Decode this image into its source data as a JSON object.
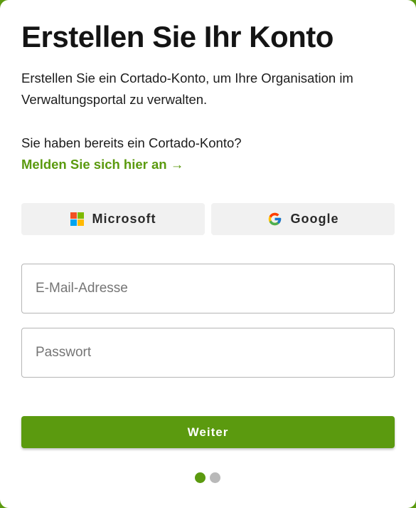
{
  "title": "Erstellen Sie Ihr Konto",
  "description": "Erstellen Sie ein Cortado-Konto, um Ihre Organisation im Verwaltungsportal zu verwalten.",
  "signin": {
    "prompt": "Sie haben bereits ein Cortado-Konto?",
    "link_label": "Melden Sie sich hier an →"
  },
  "sso": {
    "microsoft_label": "Microsoft",
    "google_label": "Google",
    "microsoft_icon": "microsoft-logo-icon",
    "google_icon": "google-logo-icon"
  },
  "form": {
    "email_placeholder": "E-Mail-Adresse",
    "email_value": "",
    "password_placeholder": "Passwort",
    "password_value": "",
    "submit_label": "Weiter"
  },
  "steps": {
    "current": 1,
    "total": 2
  },
  "colors": {
    "accent": "#5b9a0f",
    "sso_button_bg": "#f1f1f1",
    "inactive_dot": "#b9b9b9",
    "microsoft_red": "#f25022",
    "microsoft_green": "#7fba00",
    "microsoft_blue": "#00a4ef",
    "microsoft_yellow": "#ffb900"
  }
}
